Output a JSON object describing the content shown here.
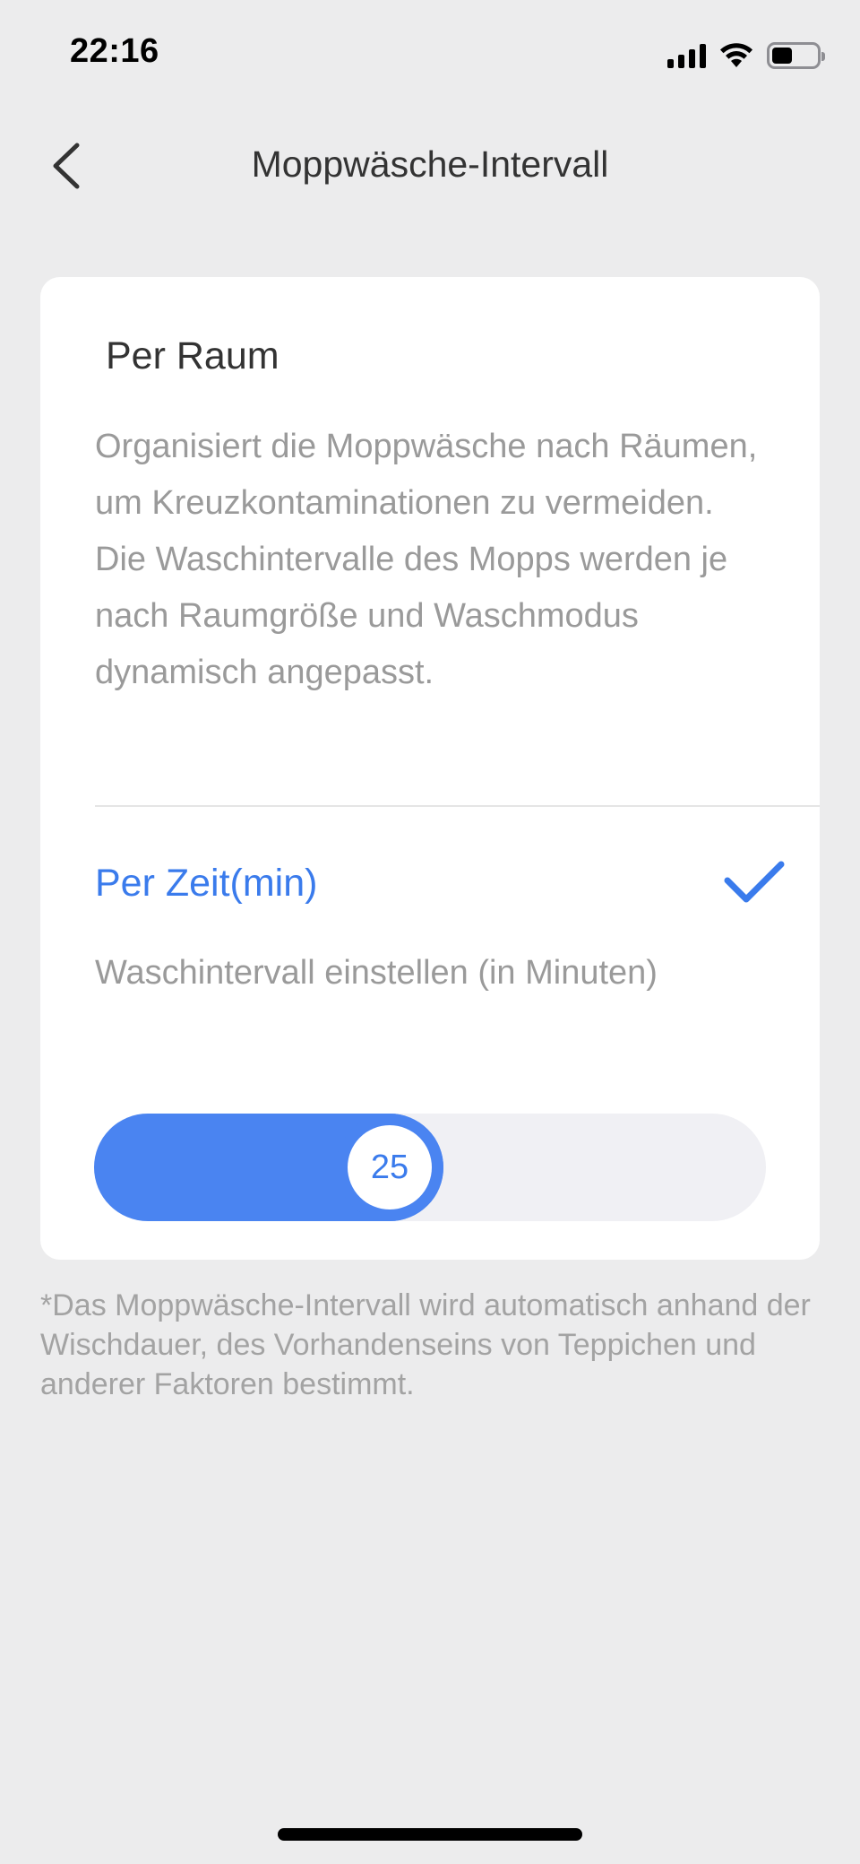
{
  "status_bar": {
    "time": "22:16",
    "icons": [
      "signal-icon",
      "wifi-icon",
      "battery-icon"
    ],
    "battery_level": 0.45
  },
  "nav": {
    "back_icon": "chevron-left-icon",
    "title": "Moppwäsche-Intervall"
  },
  "options": {
    "per_raum": {
      "title": "Per Raum",
      "description": "Organisiert die Moppwäsche nach Räumen, um Kreuzkontaminationen zu vermeiden. Die Waschintervalle des Mopps werden je nach Raumgröße und Waschmodus dynamisch angepasst.",
      "selected": false
    },
    "per_zeit": {
      "title": "Per Zeit(min)",
      "description": "Waschintervall einstellen (in Minuten)",
      "selected": true,
      "check_icon": "checkmark-icon"
    }
  },
  "slider": {
    "value": "25",
    "level": 0.36
  },
  "footnote": "*Das Moppwäsche-Intervall wird automatisch anhand der Wischdauer, des Vorhandenseins von Teppichen und anderer Faktoren bestimmt.",
  "colors": {
    "accent": "#3a7bec",
    "slider_fill": "#4a84f1",
    "background": "#ececed"
  }
}
